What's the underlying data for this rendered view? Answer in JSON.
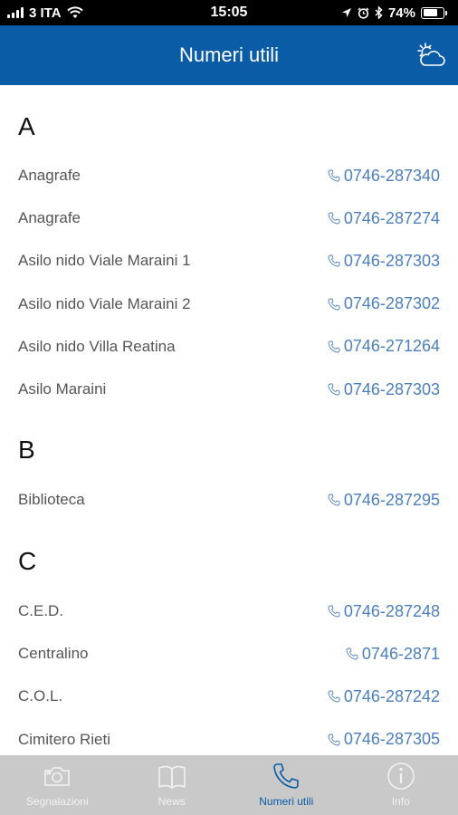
{
  "status_bar": {
    "carrier": "3 ITA",
    "time": "15:05",
    "battery": "74%",
    "battery_level": 0.74
  },
  "nav": {
    "title": "Numeri utili",
    "weather_icon": "weather-partly-cloudy-icon"
  },
  "sections": [
    {
      "letter": "A",
      "entries": [
        {
          "name": "Anagrafe",
          "phone": "0746-287340"
        },
        {
          "name": "Anagrafe",
          "phone": "0746-287274"
        },
        {
          "name": "Asilo nido Viale Maraini 1",
          "phone": "0746-287303"
        },
        {
          "name": "Asilo nido Viale Maraini 2",
          "phone": "0746-287302"
        },
        {
          "name": "Asilo nido Villa Reatina",
          "phone": "0746-271264"
        },
        {
          "name": "Asilo Maraini",
          "phone": "0746-287303"
        }
      ]
    },
    {
      "letter": "B",
      "entries": [
        {
          "name": "Biblioteca",
          "phone": "0746-287295"
        }
      ]
    },
    {
      "letter": "C",
      "entries": [
        {
          "name": "C.E.D.",
          "phone": "0746-287248"
        },
        {
          "name": "Centralino",
          "phone": "0746-2871"
        },
        {
          "name": "C.O.L.",
          "phone": "0746-287242"
        },
        {
          "name": "Cimitero Rieti",
          "phone": "0746-287305"
        }
      ]
    }
  ],
  "tabs": [
    {
      "label": "Segnalazioni",
      "icon": "camera-icon",
      "active": false
    },
    {
      "label": "News",
      "icon": "book-icon",
      "active": false
    },
    {
      "label": "Numeri utili",
      "icon": "phone-icon",
      "active": true
    },
    {
      "label": "Info",
      "icon": "info-icon",
      "active": false
    }
  ],
  "colors": {
    "nav_background": "#0a5ca6",
    "phone_link": "#4a7fbf",
    "tab_bar_background": "#c9c9c9",
    "tab_active": "#0a5ca6"
  }
}
